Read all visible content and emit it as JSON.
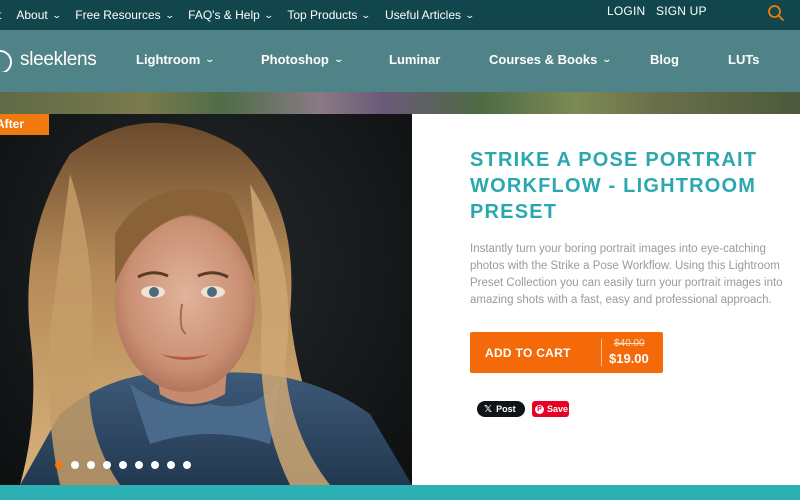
{
  "topbar": {
    "links": [
      {
        "label": "t",
        "has_dropdown": false
      },
      {
        "label": "About",
        "has_dropdown": true
      },
      {
        "label": "Free Resources",
        "has_dropdown": true
      },
      {
        "label": "FAQ's & Help",
        "has_dropdown": true
      },
      {
        "label": "Top Products",
        "has_dropdown": true
      },
      {
        "label": "Useful Articles",
        "has_dropdown": true
      }
    ],
    "login": "LOGIN",
    "signup": "SIGN UP",
    "search_icon": "search-icon"
  },
  "nav": {
    "logo": "sleeklens",
    "items": [
      {
        "label": "Lightroom",
        "has_dropdown": true
      },
      {
        "label": "Photoshop",
        "has_dropdown": true
      },
      {
        "label": "Luminar",
        "has_dropdown": false
      },
      {
        "label": "Courses & Books",
        "has_dropdown": true
      },
      {
        "label": "Blog",
        "has_dropdown": false
      },
      {
        "label": "LUTs",
        "has_dropdown": false
      }
    ]
  },
  "slider": {
    "badge": "After",
    "dot_count": 9,
    "active_dot": 0
  },
  "product": {
    "title": "STRIKE A POSE PORTRAIT WORKFLOW - LIGHTROOM PRESET",
    "description": "Instantly turn your boring portrait images into eye-catching photos with the Strike a Pose Workflow. Using this Lightroom Preset Collection you can easily turn your portrait images into amazing shots with a fast, easy and professional approach.",
    "cart_label": "ADD TO CART",
    "old_price": "$40.00",
    "new_price": "$19.00"
  },
  "share": {
    "x_post": "Post",
    "pin_save": "Save"
  },
  "colors": {
    "topbar": "#11474c",
    "nav": "#4f8388",
    "accent_teal": "#2aa8ae",
    "accent_orange": "#f46a0a"
  }
}
